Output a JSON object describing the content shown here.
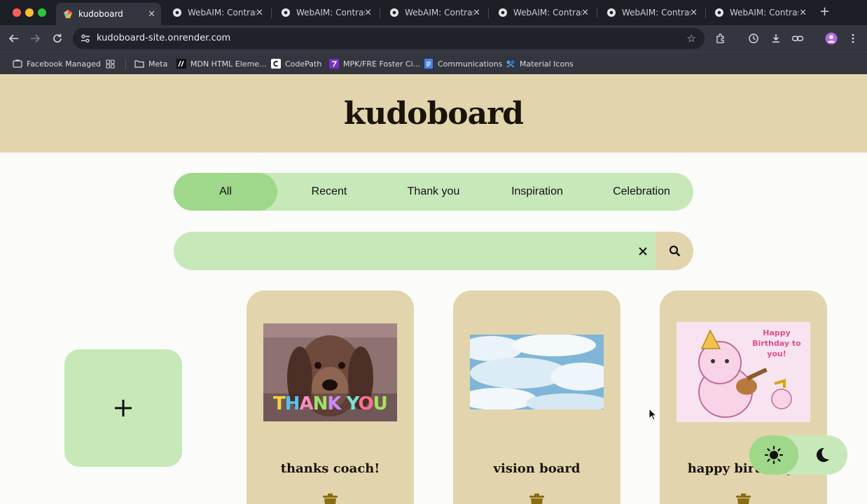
{
  "browser": {
    "tabs": [
      {
        "title": "kudoboard",
        "active": true,
        "icon": "kudoboard-favicon"
      },
      {
        "title": "WebAIM: Contrast",
        "active": false,
        "icon": "webaim-gear-favicon"
      },
      {
        "title": "WebAIM: Contrast",
        "active": false,
        "icon": "webaim-gear-favicon"
      },
      {
        "title": "WebAIM: Contrast",
        "active": false,
        "icon": "webaim-gear-favicon"
      },
      {
        "title": "WebAIM: Contrast",
        "active": false,
        "icon": "webaim-gear-favicon"
      },
      {
        "title": "WebAIM: Contrast",
        "active": false,
        "icon": "webaim-gear-favicon"
      },
      {
        "title": "WebAIM: Contrast",
        "active": false,
        "icon": "webaim-gear-favicon"
      }
    ],
    "close_glyph": "×",
    "new_tab_glyph": "+",
    "url": "kudoboard-site.onrender.com",
    "bookmarks": [
      {
        "label": "Facebook Managed",
        "icon": "briefcase-folder-icon"
      },
      {
        "label": "",
        "icon": "apps-grid-icon"
      },
      {
        "label": "Meta",
        "icon": "folder-icon"
      },
      {
        "label": "MDN HTML Eleme...",
        "icon": "mdn-logo-icon"
      },
      {
        "label": "CodePath",
        "icon": "codepath-logo-icon"
      },
      {
        "label": "MPK/FRE Foster Ci...",
        "icon": "mpk-logo-icon"
      },
      {
        "label": "Communications",
        "icon": "google-docs-icon"
      },
      {
        "label": "Material Icons",
        "icon": "material-icons-logo-icon"
      }
    ]
  },
  "site": {
    "title": "kudoboard",
    "filters": [
      "All",
      "Recent",
      "Thank you",
      "Inspiration",
      "Celebration"
    ],
    "active_filter": "All",
    "search": {
      "value": "",
      "placeholder": "",
      "clear_glyph": "✕"
    },
    "add_board_glyph": "+",
    "boards": [
      {
        "title": "thanks coach!",
        "image": "dog-thank-you-gif",
        "image_text": "THANK YOU"
      },
      {
        "title": "vision board",
        "image": "clouds-sky-photo"
      },
      {
        "title": "happy birthday!",
        "image": "cat-birthday-illustration",
        "image_text": "Happy Birthday to you!"
      }
    ],
    "theme": {
      "active": "light",
      "options": [
        "light",
        "dark"
      ]
    }
  },
  "colors": {
    "header_bg": "#e2d5ad",
    "pill_bg": "#c7e8b9",
    "pill_active": "#9fd88a",
    "card_bg": "#e2d5ad",
    "text_dark": "#1a1408",
    "trash": "#8a6d12"
  }
}
